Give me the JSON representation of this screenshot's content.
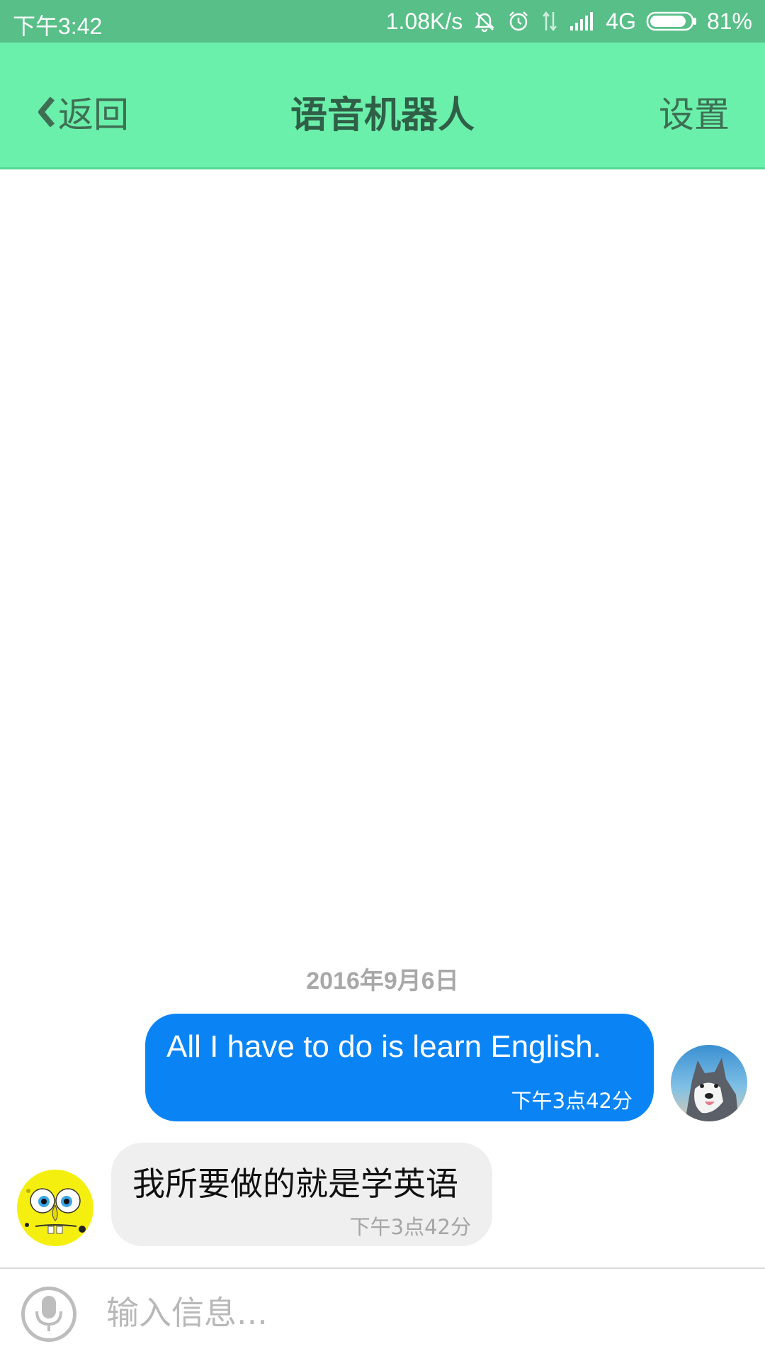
{
  "status_bar": {
    "time": "下午3:42",
    "net_speed": "1.08K/s",
    "network": "4G",
    "battery": "81%",
    "icons": [
      "mute-icon",
      "alarm-icon",
      "data-arrows-icon",
      "signal-icon",
      "battery-icon"
    ]
  },
  "header": {
    "back_label": "返回",
    "title": "语音机器人",
    "settings_label": "设置"
  },
  "chat": {
    "date": "2016年9月6日",
    "messages": [
      {
        "side": "right",
        "text": "All I have to do is learn English.",
        "time": "下午3点42分"
      },
      {
        "side": "left",
        "text": "我所要做的就是学英语",
        "time": "下午3点42分"
      }
    ]
  },
  "input": {
    "placeholder": "输入信息..."
  },
  "colors": {
    "status_bar": "#58bf88",
    "title_bar": "#6bf0ab",
    "outgoing_bubble": "#0a84f5",
    "incoming_bubble": "#efefef"
  }
}
